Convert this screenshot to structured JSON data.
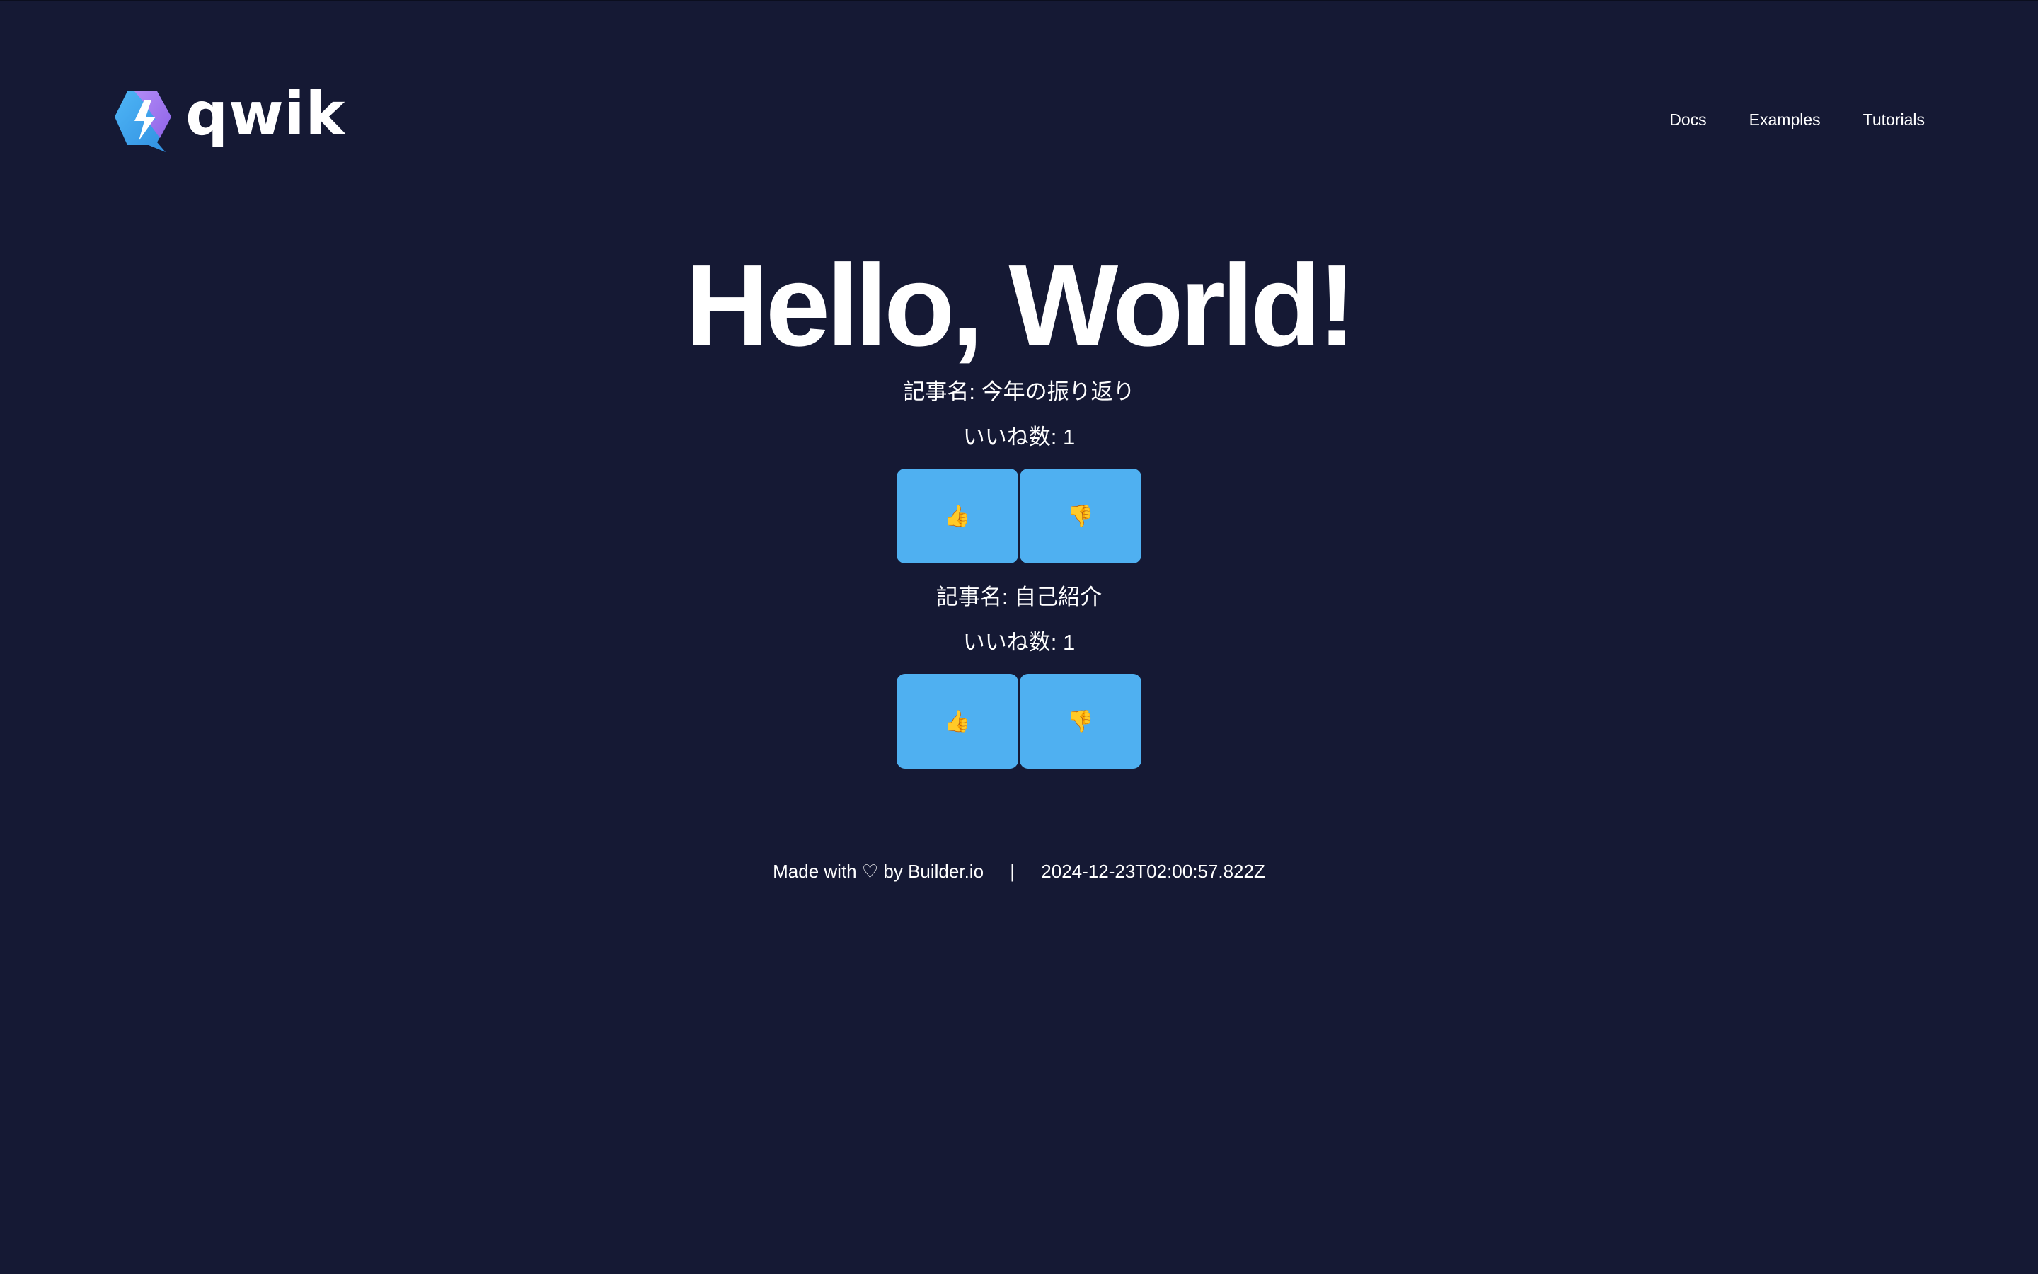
{
  "brand": {
    "name": "qwik"
  },
  "nav": {
    "items": [
      {
        "label": "Docs"
      },
      {
        "label": "Examples"
      },
      {
        "label": "Tutorials"
      }
    ]
  },
  "main": {
    "heading": "Hello, World!",
    "articles": [
      {
        "title": "記事名: 今年の振り返り",
        "likes": "いいね数: 1",
        "like_button": "👍",
        "dislike_button": "👎"
      },
      {
        "title": "記事名: 自己紹介",
        "likes": "いいね数: 1",
        "like_button": "👍",
        "dislike_button": "👎"
      }
    ]
  },
  "footer": {
    "made_with": "Made with ♡ by Builder.io",
    "separator": "|",
    "timestamp": "2024-12-23T02:00:57.822Z"
  },
  "colors": {
    "background": "#151934",
    "button": "#4fb0f1",
    "text": "#ffffff"
  }
}
